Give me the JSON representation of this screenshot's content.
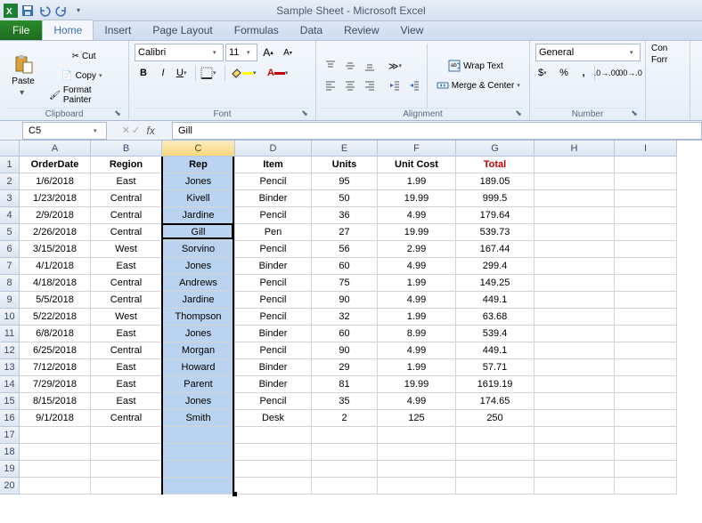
{
  "app": {
    "title": "Sample Sheet - Microsoft Excel"
  },
  "tabs": {
    "file": "File",
    "home": "Home",
    "insert": "Insert",
    "pagelayout": "Page Layout",
    "formulas": "Formulas",
    "data": "Data",
    "review": "Review",
    "view": "View"
  },
  "ribbon": {
    "clipboard": {
      "paste": "Paste",
      "cut": "Cut",
      "copy": "Copy",
      "fmtpaint": "Format Painter",
      "label": "Clipboard"
    },
    "font": {
      "name": "Calibri",
      "size": "11",
      "label": "Font"
    },
    "alignment": {
      "wrap": "Wrap Text",
      "merge": "Merge & Center",
      "label": "Alignment"
    },
    "number": {
      "format": "General",
      "label": "Number"
    },
    "more": {
      "cond": "Con",
      "form": "Forr"
    }
  },
  "fbar": {
    "cellref": "C5",
    "value": "Gill"
  },
  "columns": [
    "A",
    "B",
    "C",
    "D",
    "E",
    "F",
    "G",
    "H",
    "I"
  ],
  "headers": [
    "OrderDate",
    "Region",
    "Rep",
    "Item",
    "Units",
    "Unit Cost",
    "Total"
  ],
  "selectedCol": 2,
  "rows": [
    {
      "n": 2,
      "d": [
        "1/6/2018",
        "East",
        "Jones",
        "Pencil",
        "95",
        "1.99",
        "189.05"
      ]
    },
    {
      "n": 3,
      "d": [
        "1/23/2018",
        "Central",
        "Kivell",
        "Binder",
        "50",
        "19.99",
        "999.5"
      ]
    },
    {
      "n": 4,
      "d": [
        "2/9/2018",
        "Central",
        "Jardine",
        "Pencil",
        "36",
        "4.99",
        "179.64"
      ]
    },
    {
      "n": 5,
      "d": [
        "2/26/2018",
        "Central",
        "Gill",
        "Pen",
        "27",
        "19.99",
        "539.73"
      ]
    },
    {
      "n": 6,
      "d": [
        "3/15/2018",
        "West",
        "Sorvino",
        "Pencil",
        "56",
        "2.99",
        "167.44"
      ]
    },
    {
      "n": 7,
      "d": [
        "4/1/2018",
        "East",
        "Jones",
        "Binder",
        "60",
        "4.99",
        "299.4"
      ]
    },
    {
      "n": 8,
      "d": [
        "4/18/2018",
        "Central",
        "Andrews",
        "Pencil",
        "75",
        "1.99",
        "149.25"
      ]
    },
    {
      "n": 9,
      "d": [
        "5/5/2018",
        "Central",
        "Jardine",
        "Pencil",
        "90",
        "4.99",
        "449.1"
      ]
    },
    {
      "n": 10,
      "d": [
        "5/22/2018",
        "West",
        "Thompson",
        "Pencil",
        "32",
        "1.99",
        "63.68"
      ]
    },
    {
      "n": 11,
      "d": [
        "6/8/2018",
        "East",
        "Jones",
        "Binder",
        "60",
        "8.99",
        "539.4"
      ]
    },
    {
      "n": 12,
      "d": [
        "6/25/2018",
        "Central",
        "Morgan",
        "Pencil",
        "90",
        "4.99",
        "449.1"
      ]
    },
    {
      "n": 13,
      "d": [
        "7/12/2018",
        "East",
        "Howard",
        "Binder",
        "29",
        "1.99",
        "57.71"
      ]
    },
    {
      "n": 14,
      "d": [
        "7/29/2018",
        "East",
        "Parent",
        "Binder",
        "81",
        "19.99",
        "1619.19"
      ]
    },
    {
      "n": 15,
      "d": [
        "8/15/2018",
        "East",
        "Jones",
        "Pencil",
        "35",
        "4.99",
        "174.65"
      ]
    },
    {
      "n": 16,
      "d": [
        "9/1/2018",
        "Central",
        "Smith",
        "Desk",
        "2",
        "125",
        "250"
      ]
    }
  ],
  "emptyRows": [
    17,
    18,
    19,
    20
  ]
}
